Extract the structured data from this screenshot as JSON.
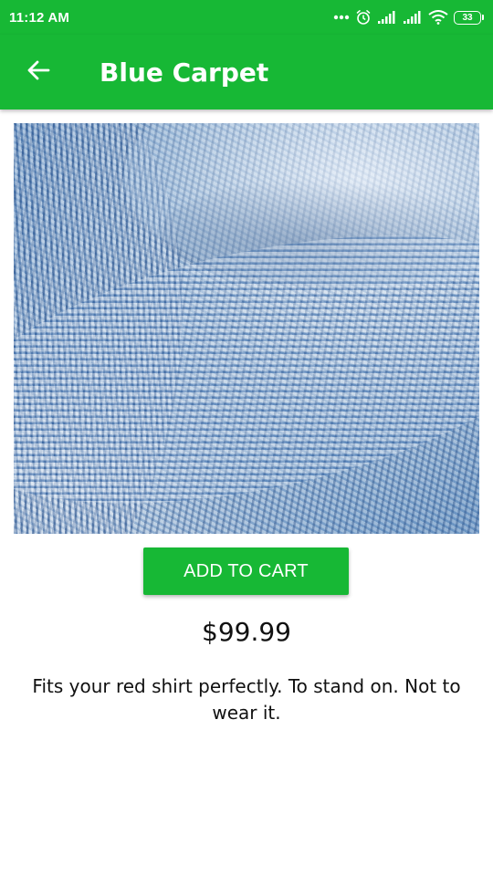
{
  "status_bar": {
    "time": "11:12 AM",
    "battery_level": "33",
    "icons": [
      "more-dots-icon",
      "alarm-icon",
      "signal-icon",
      "signal-icon",
      "wifi-icon",
      "battery-icon"
    ]
  },
  "app_bar": {
    "title": "Blue Carpet",
    "back_icon": "arrow-back-icon"
  },
  "product": {
    "image_description_icon": "product-image",
    "add_to_cart_label": "ADD TO CART",
    "price": "$99.99",
    "description": "Fits your red shirt perfectly. To stand on. Not to wear it."
  },
  "colors": {
    "primary": "#17b835",
    "text": "#111111",
    "background": "#ffffff"
  }
}
